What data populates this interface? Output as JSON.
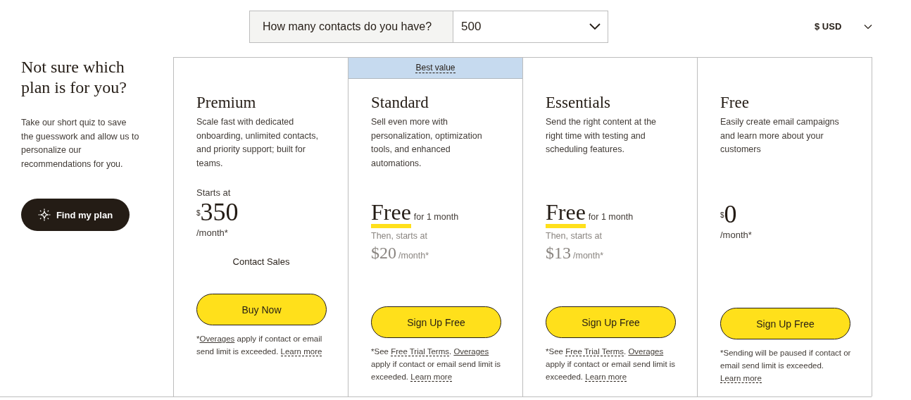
{
  "contacts_selector": {
    "label": "How many contacts do you have?",
    "value": "500"
  },
  "currency_selector": {
    "value": "$ USD"
  },
  "intro": {
    "heading": "Not sure which plan is for you?",
    "text": "Take our short quiz to save the guesswork and allow us to personalize our recommendations for you.",
    "button": "Find my plan"
  },
  "plans": [
    {
      "name": "Premium",
      "description": "Scale fast with dedicated onboarding, unlimited contacts, and priority support; built for teams.",
      "price": {
        "kind": "starts",
        "label": "Starts at",
        "currency": "$",
        "amount": "350",
        "period": "/month*",
        "extra": "Contact Sales"
      },
      "button": "Buy Now",
      "footnote": [
        {
          "kind": "text",
          "text": "*"
        },
        {
          "kind": "link",
          "text": "Overages"
        },
        {
          "kind": "text",
          "text": " apply if contact or email send limit is exceeded. "
        },
        {
          "kind": "term",
          "text": "Learn more"
        }
      ]
    },
    {
      "name": "Standard",
      "badge": "Best value",
      "description": "Sell even more with personalization, optimization tools, and enhanced automations.",
      "price": {
        "kind": "trial",
        "free": "Free",
        "note": "for 1 month",
        "label": "Then, starts at",
        "amount": "$20",
        "period": "/month*"
      },
      "button": "Sign Up Free",
      "footnote": [
        {
          "kind": "text",
          "text": "*See "
        },
        {
          "kind": "term",
          "text": "Free Trial Terms"
        },
        {
          "kind": "text",
          "text": ". "
        },
        {
          "kind": "link",
          "text": "Overages"
        },
        {
          "kind": "text",
          "text": " apply if contact or email send limit is exceeded. "
        },
        {
          "kind": "term",
          "text": "Learn more"
        }
      ]
    },
    {
      "name": "Essentials",
      "description": "Send the right content at the right time with testing and scheduling features.",
      "price": {
        "kind": "trial",
        "free": "Free",
        "note": "for 1 month",
        "label": "Then, starts at",
        "amount": "$13",
        "period": "/month*"
      },
      "button": "Sign Up Free",
      "footnote": [
        {
          "kind": "text",
          "text": "*See "
        },
        {
          "kind": "term",
          "text": "Free Trial Terms"
        },
        {
          "kind": "text",
          "text": ". "
        },
        {
          "kind": "link",
          "text": "Overages"
        },
        {
          "kind": "text",
          "text": " apply if contact or email send limit is exceeded. "
        },
        {
          "kind": "term",
          "text": "Learn more"
        }
      ]
    },
    {
      "name": "Free",
      "description": "Easily create email campaigns and learn more about your customers",
      "price": {
        "kind": "flat",
        "currency": "$",
        "amount": "0",
        "period": "/month*"
      },
      "button": "Sign Up Free",
      "footnote": [
        {
          "kind": "text",
          "text": "*Sending will be paused if contact or email send limit is exceeded. "
        },
        {
          "kind": "term",
          "text": "Learn more"
        }
      ]
    }
  ]
}
